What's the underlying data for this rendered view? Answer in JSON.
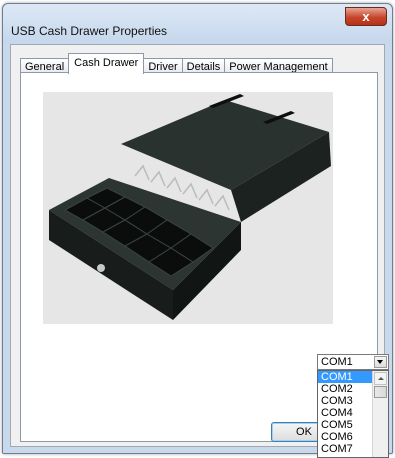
{
  "window": {
    "title": "USB Cash Drawer Properties",
    "close_glyph": "x"
  },
  "tabs": [
    {
      "label": "General"
    },
    {
      "label": "Cash Drawer"
    },
    {
      "label": "Driver"
    },
    {
      "label": "Details"
    },
    {
      "label": "Power Management"
    }
  ],
  "active_tab": "Cash Drawer",
  "image": {
    "subject": "black cash drawer with open till"
  },
  "port_select": {
    "value": "COM1",
    "options": [
      "COM1",
      "COM2",
      "COM3",
      "COM4",
      "COM5",
      "COM6",
      "COM7"
    ],
    "highlighted": "COM1"
  },
  "buttons": {
    "ok_label": "OK",
    "cancel_label": ""
  },
  "colors": {
    "selection": "#3399ff",
    "close_button": "#c7452b"
  }
}
